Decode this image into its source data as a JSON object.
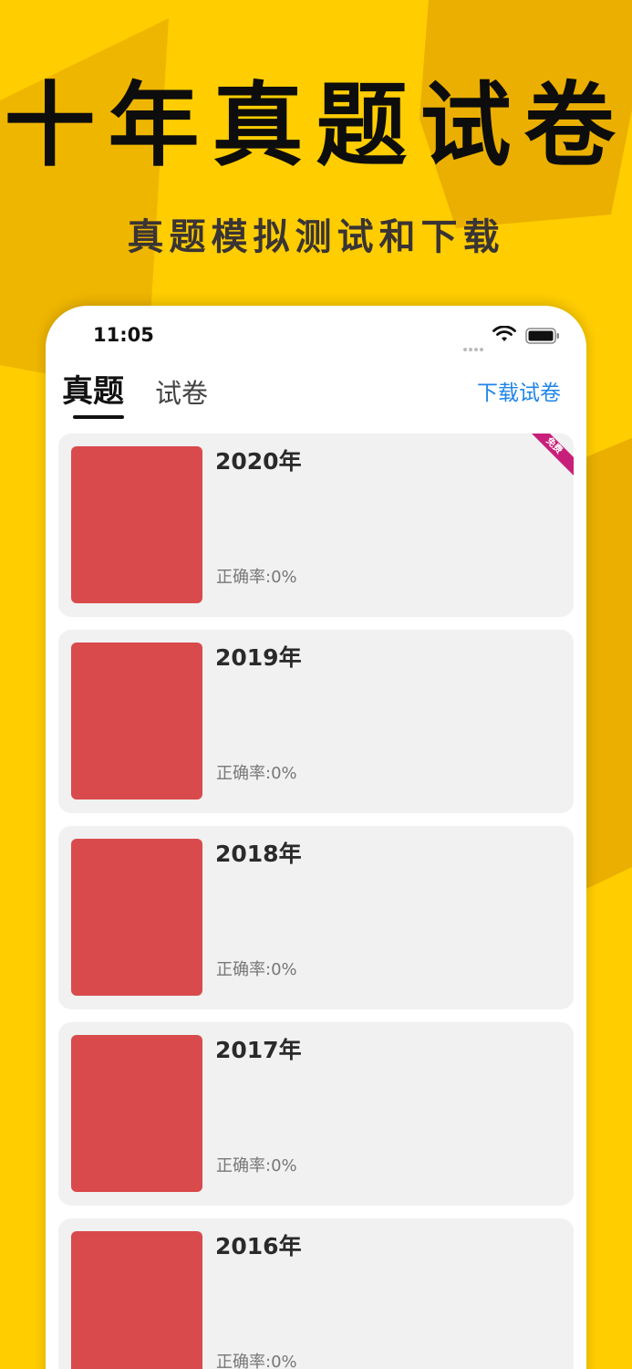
{
  "promo": {
    "headline": "十年真题试卷",
    "subheadline": "真题模拟测试和下载"
  },
  "status_bar": {
    "time": "11:05",
    "icons": [
      "signal-icon",
      "wifi-icon",
      "battery-icon"
    ]
  },
  "nav": {
    "tab_active": "真题",
    "tab_inactive": "试卷",
    "download_label": "下载试卷"
  },
  "papers": [
    {
      "title": "2020年",
      "accuracy": "正确率:0%",
      "badge": "免费"
    },
    {
      "title": "2019年",
      "accuracy": "正确率:0%"
    },
    {
      "title": "2018年",
      "accuracy": "正确率:0%"
    },
    {
      "title": "2017年",
      "accuracy": "正确率:0%"
    },
    {
      "title": "2016年",
      "accuracy": "正确率:0%"
    }
  ],
  "colors": {
    "background": "#ffcd00",
    "cover": "#d94a4c",
    "link": "#1f85ea",
    "badge": "#c8207a"
  }
}
